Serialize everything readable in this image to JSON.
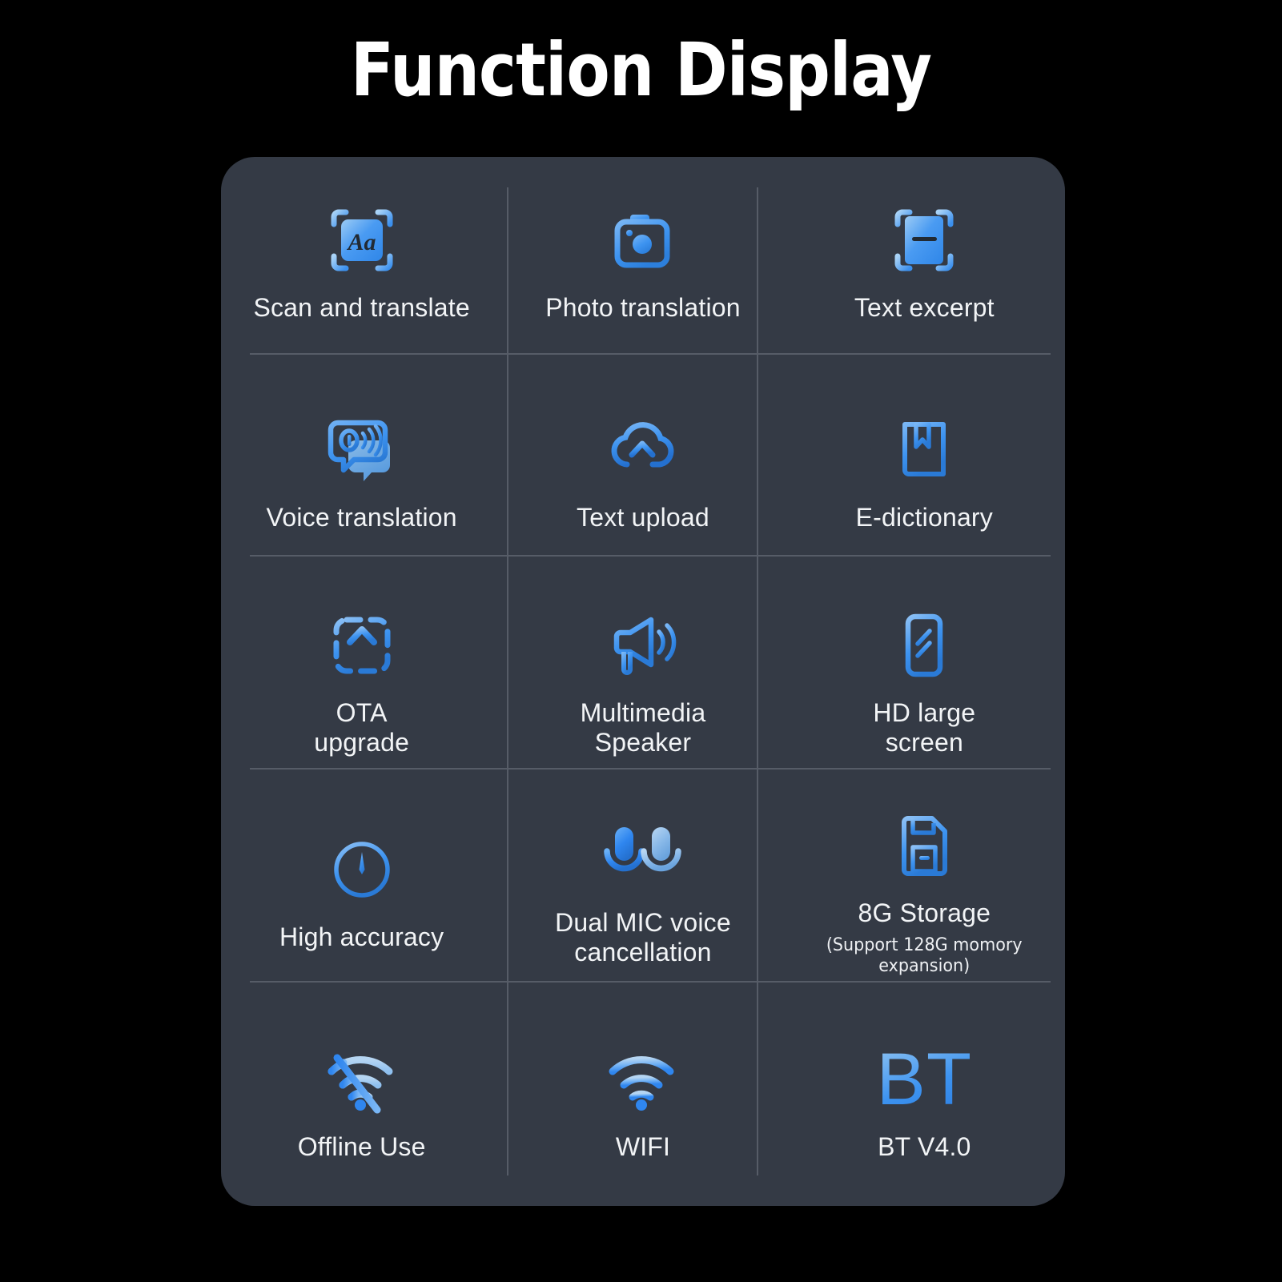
{
  "page": {
    "title": "Function Display",
    "background_color": "#000000",
    "card_color": "#343a45",
    "accent_color": "#3d93f0",
    "accent_light": "#8fc2f0",
    "text_color": "#f2f4f6",
    "divider_color": "#565c67"
  },
  "features": [
    {
      "id": "scan-and-translate",
      "label": "Scan and translate",
      "icon": "scan-text-icon",
      "sublabel": ""
    },
    {
      "id": "photo-translation",
      "label": "Photo translation",
      "icon": "camera-icon",
      "sublabel": ""
    },
    {
      "id": "text-excerpt",
      "label": "Text excerpt",
      "icon": "scan-excerpt-icon",
      "sublabel": ""
    },
    {
      "id": "voice-translation",
      "label": "Voice translation",
      "icon": "speech-bubble-sound-icon",
      "sublabel": ""
    },
    {
      "id": "text-upload",
      "label": "Text upload",
      "icon": "cloud-upload-icon",
      "sublabel": ""
    },
    {
      "id": "e-dictionary",
      "label": "E-dictionary",
      "icon": "book-bookmark-icon",
      "sublabel": ""
    },
    {
      "id": "ota-upgrade",
      "label": "OTA\nupgrade",
      "icon": "dashed-upload-icon",
      "sublabel": ""
    },
    {
      "id": "multimedia-speaker",
      "label": "Multimedia\nSpeaker",
      "icon": "megaphone-icon",
      "sublabel": ""
    },
    {
      "id": "hd-large-screen",
      "label": "HD large\nscreen",
      "icon": "phone-screen-icon",
      "sublabel": ""
    },
    {
      "id": "high-accuracy",
      "label": "High accuracy",
      "icon": "crosshair-target-icon",
      "sublabel": ""
    },
    {
      "id": "dual-mic-voice-cancellation",
      "label": "Dual MIC voice\ncancellation",
      "icon": "dual-microphone-icon",
      "sublabel": ""
    },
    {
      "id": "storage",
      "label": "8G Storage",
      "icon": "memory-card-icon",
      "sublabel": "(Support 128G momory\nexpansion)"
    },
    {
      "id": "offline-use",
      "label": "Offline Use",
      "icon": "wifi-off-icon",
      "sublabel": ""
    },
    {
      "id": "wifi",
      "label": "WIFI",
      "icon": "wifi-icon",
      "sublabel": ""
    },
    {
      "id": "bluetooth",
      "label": "BT V4.0",
      "icon": "bt-text-glyph",
      "glyph": "BT",
      "sublabel": ""
    }
  ]
}
